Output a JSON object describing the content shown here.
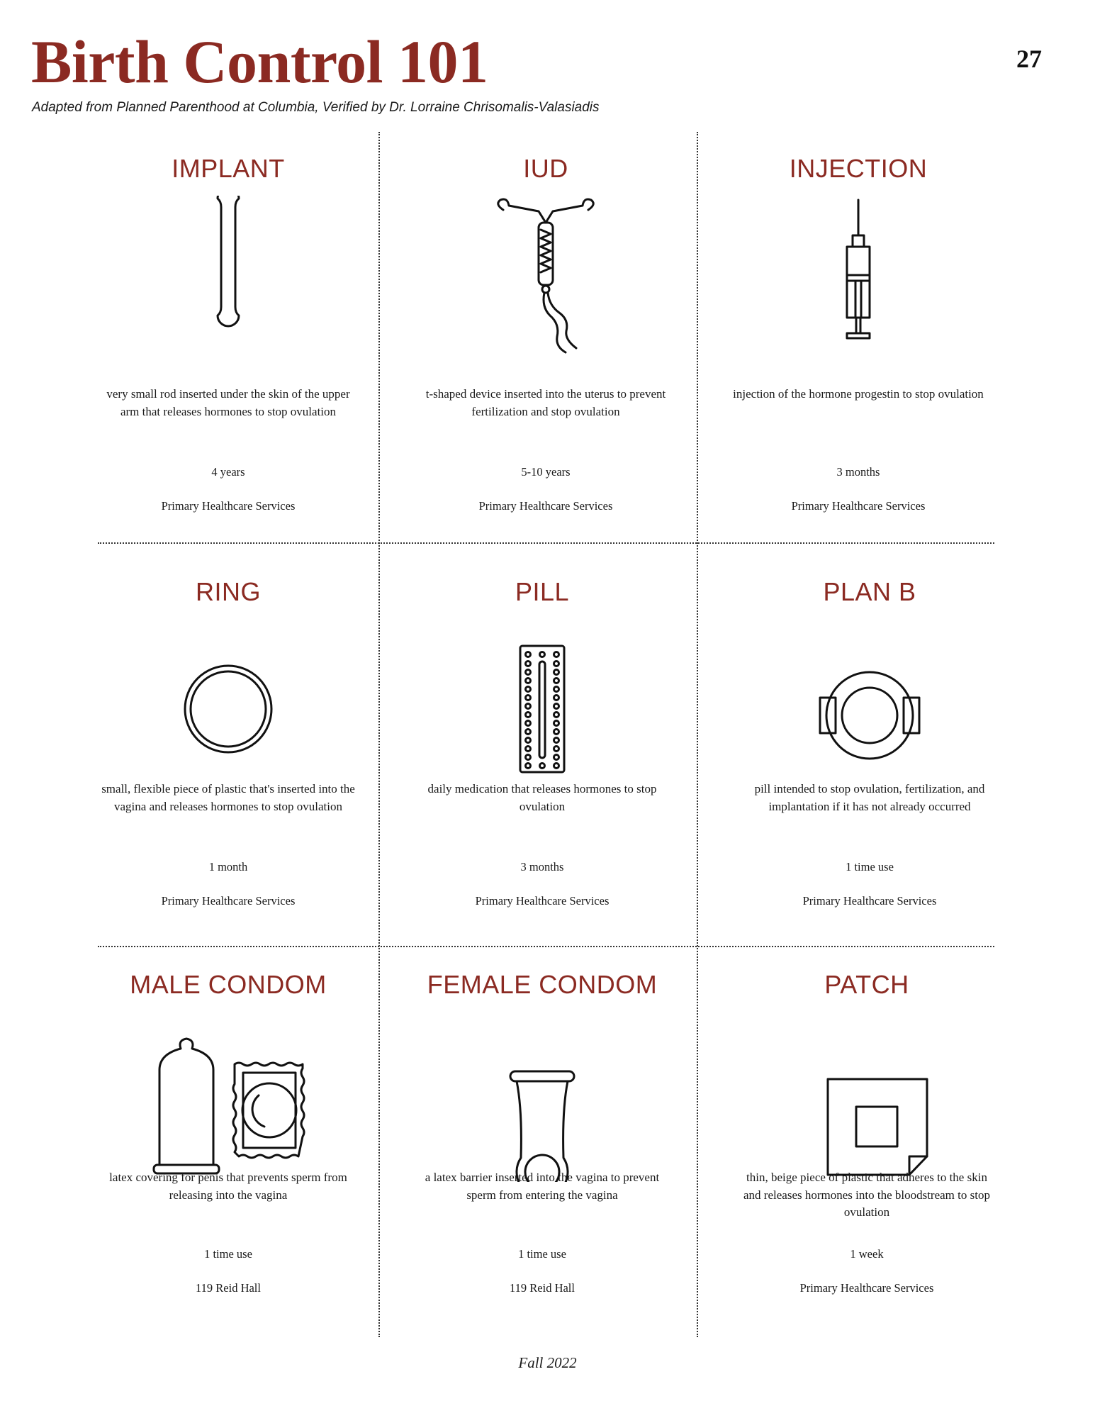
{
  "header": {
    "title": "Birth Control 101",
    "page_number": "27",
    "subtitle": "Adapted from Planned Parenthood at Columbia, Verified by Dr. Lorraine Chrisomalis-Valasiadis"
  },
  "methods": [
    {
      "name": "IMPLANT",
      "description": "very small rod inserted under the skin of the upper arm that releases hormones to stop ovulation",
      "duration": "4 years",
      "location": "Primary Healthcare Services",
      "icon": "implant-rod-icon"
    },
    {
      "name": "IUD",
      "description": "t-shaped device inserted into the uterus to prevent fertilization and stop ovulation",
      "duration": "5-10 years",
      "location": "Primary Healthcare Services",
      "icon": "iud-icon"
    },
    {
      "name": "INJECTION",
      "description": "injection of the hormone progestin to stop ovulation",
      "duration": "3 months",
      "location": "Primary Healthcare Services",
      "icon": "syringe-icon"
    },
    {
      "name": "RING",
      "description": "small, flexible piece of plastic that's inserted into the vagina and releases hormones to stop ovulation",
      "duration": "1 month",
      "location": "Primary Healthcare Services",
      "icon": "ring-icon"
    },
    {
      "name": "PILL",
      "description": "daily medication that releases hormones to stop ovulation",
      "duration": "3 months",
      "location": "Primary Healthcare Services",
      "icon": "pill-pack-icon"
    },
    {
      "name": "PLAN B",
      "description": "pill intended to stop ovulation, fertilization, and implantation if it has not already occurred",
      "duration": "1 time use",
      "location": "Primary Healthcare Services",
      "icon": "plan-b-pill-icon"
    },
    {
      "name": "MALE CONDOM",
      "description": "latex covering for penis that prevents sperm from releasing into the vagina",
      "duration": "1 time use",
      "location": "119 Reid Hall",
      "icon": "male-condom-icon"
    },
    {
      "name": "FEMALE CONDOM",
      "description": "a latex barrier inserted into the vagina to prevent sperm from entering the vagina",
      "duration": "1 time use",
      "location": "119 Reid Hall",
      "icon": "female-condom-icon"
    },
    {
      "name": "PATCH",
      "description": "thin, beige piece of plastic that adheres to the skin and releases hormones into the bloodstream to stop ovulation",
      "duration": "1 week",
      "location": "Primary Healthcare Services",
      "icon": "patch-icon"
    }
  ],
  "footer": {
    "edition": "Fall 2022"
  },
  "colors": {
    "accent": "#8b2a22",
    "text": "#1a1a1a"
  }
}
